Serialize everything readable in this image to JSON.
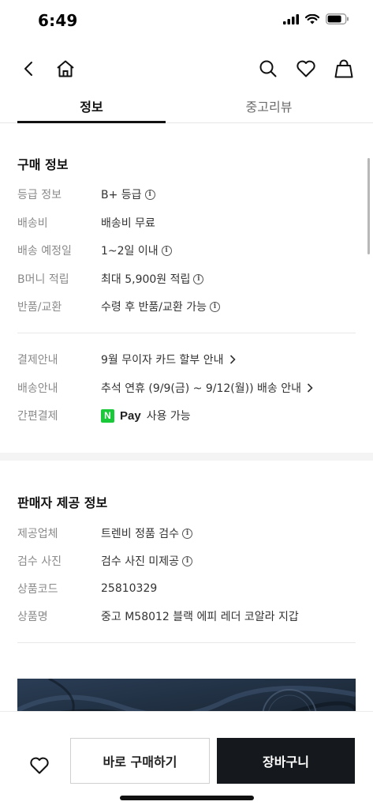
{
  "status_bar": {
    "time": "6:49"
  },
  "tabs": [
    {
      "label": "정보"
    },
    {
      "label": "중고리뷰"
    }
  ],
  "purchase_info": {
    "title": "구매 정보",
    "rows": [
      {
        "label": "등급 정보",
        "value": "B+ 등급"
      },
      {
        "label": "배송비",
        "value": "배송비 무료"
      },
      {
        "label": "배송 예정일",
        "value": "1~2일 이내"
      },
      {
        "label": "B머니 적립",
        "value": "최대 5,900원 적립"
      },
      {
        "label": "반품/교환",
        "value": "수령 후 반품/교환 가능"
      }
    ]
  },
  "payment_info": {
    "rows": [
      {
        "label": "결제안내",
        "value": "9월 무이자 카드 할부 안내"
      },
      {
        "label": "배송안내",
        "value": "추석 연휴 (9/9(금) ~ 9/12(월)) 배송 안내"
      },
      {
        "label": "간편결제",
        "logo": "N",
        "pay_label": "Pay",
        "value": "사용 가능"
      }
    ]
  },
  "seller_info": {
    "title": "판매자 제공 정보",
    "rows": [
      {
        "label": "제공업체",
        "value": "트렌비 정품 검수"
      },
      {
        "label": "검수 사진",
        "value": "검수 사진 미제공"
      },
      {
        "label": "상품코드",
        "value": "25810329"
      },
      {
        "label": "상품명",
        "value": "중고 M58012 블랙 에피 레더 코알라 지갑"
      }
    ]
  },
  "bottom_bar": {
    "buy_now_label": "바로 구매하기",
    "cart_label": "장바구니"
  },
  "colors": {
    "primary_dark": "#15191d",
    "npay_green": "#19c93a",
    "label_gray": "#8a8a8a"
  },
  "icons": [
    "back-arrow-icon",
    "home-icon",
    "search-icon",
    "heart-icon",
    "shopping-bag-icon",
    "info-icon",
    "chevron-right-icon",
    "signal-icon",
    "wifi-icon",
    "battery-icon"
  ]
}
